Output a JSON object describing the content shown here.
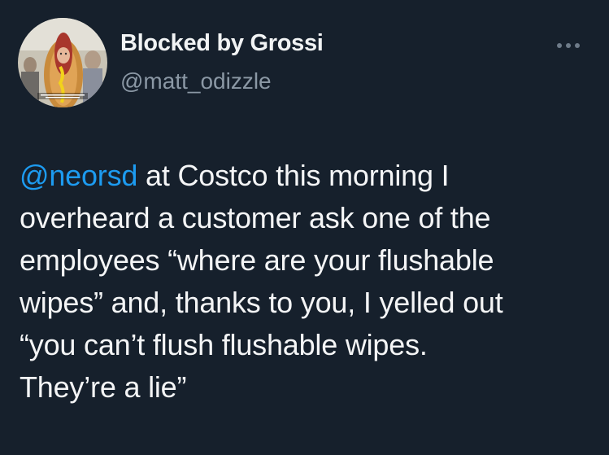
{
  "tweet": {
    "display_name": "Blocked by Grossi",
    "handle": "@matt_odizzle",
    "more_icon": "more-horizontal-icon",
    "mention": "@neorsd",
    "line1_rest": " at Costco this morning I",
    "lines": [
      "overheard a customer ask one of the",
      "employees “where are your flushable",
      "wipes” and, thanks to you, I yelled out",
      "“you can’t flush flushable wipes.",
      "They’re a lie”"
    ]
  },
  "colors": {
    "background": "#16202c",
    "text": "#f4f5f6",
    "secondary_text": "#8b98a5",
    "link": "#1d9bf0"
  }
}
